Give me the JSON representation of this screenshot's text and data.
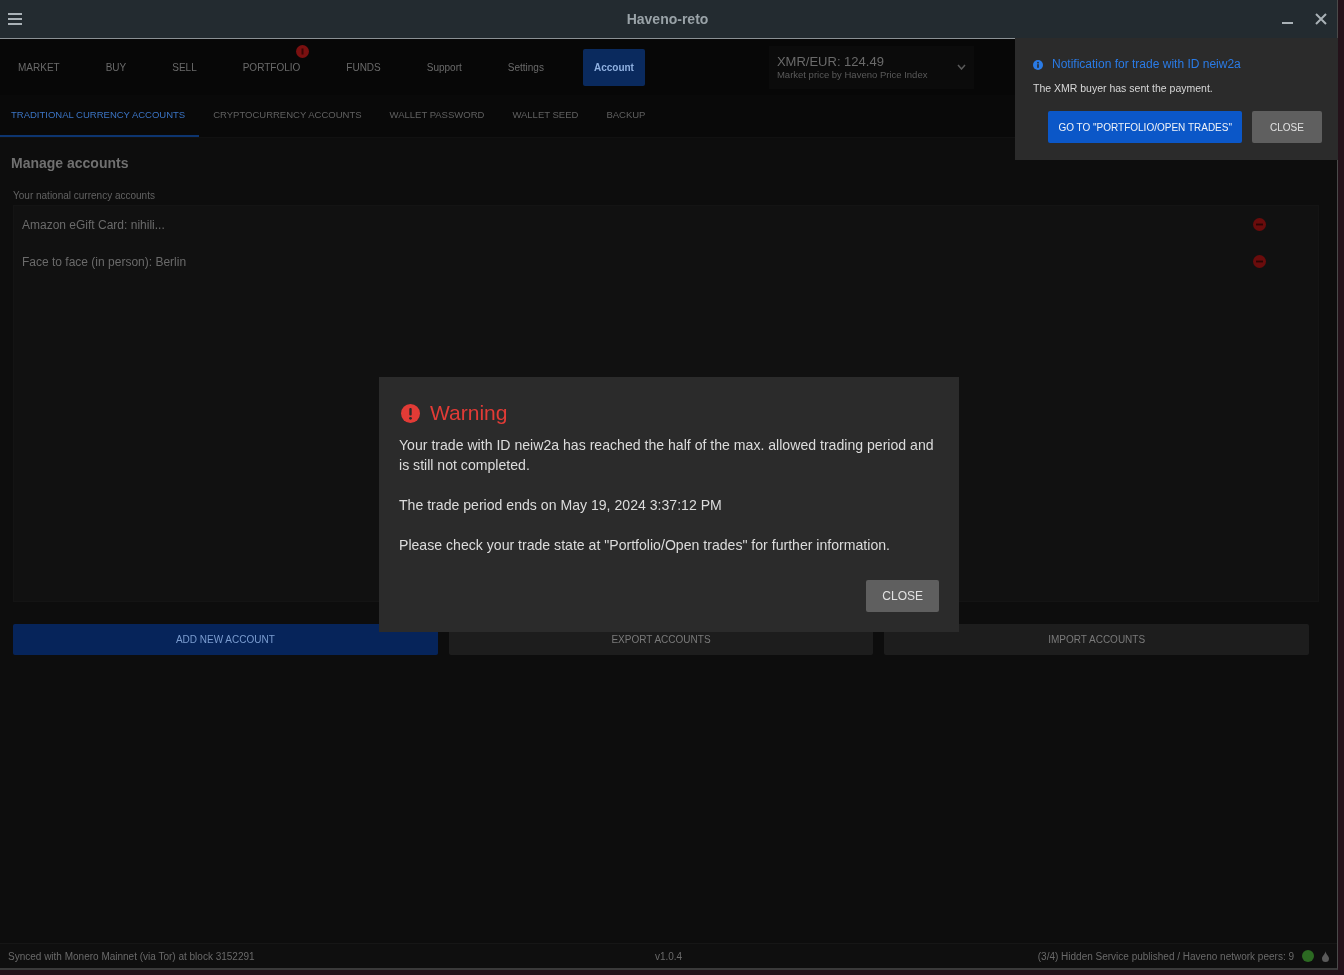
{
  "window": {
    "title": "Haveno-reto"
  },
  "nav": {
    "items": [
      {
        "label": "MARKET",
        "selected": false,
        "badge": false
      },
      {
        "label": "BUY",
        "selected": false,
        "badge": false
      },
      {
        "label": "SELL",
        "selected": false,
        "badge": false
      },
      {
        "label": "PORTFOLIO",
        "selected": false,
        "badge": true
      },
      {
        "label": "FUNDS",
        "selected": false,
        "badge": false
      },
      {
        "label": "Support",
        "selected": false,
        "badge": false
      },
      {
        "label": "Settings",
        "selected": false,
        "badge": false
      },
      {
        "label": "Account",
        "selected": true,
        "badge": false
      }
    ]
  },
  "market_price": {
    "price": "XMR/EUR: 124.49",
    "source": "Market price by Haveno Price Index"
  },
  "subtabs": [
    {
      "label": "TRADITIONAL CURRENCY ACCOUNTS",
      "selected": true
    },
    {
      "label": "CRYPTOCURRENCY ACCOUNTS",
      "selected": false
    },
    {
      "label": "WALLET PASSWORD",
      "selected": false
    },
    {
      "label": "WALLET SEED",
      "selected": false
    },
    {
      "label": "BACKUP",
      "selected": false
    }
  ],
  "content": {
    "title": "Manage accounts",
    "list_label": "Your national currency accounts",
    "accounts": [
      {
        "name": "Amazon eGift Card: nihili..."
      },
      {
        "name": "Face to face (in person): Berlin"
      }
    ],
    "buttons": [
      {
        "label": "ADD NEW ACCOUNT",
        "kind": "primary"
      },
      {
        "label": "EXPORT ACCOUNTS",
        "kind": "secondary"
      },
      {
        "label": "IMPORT ACCOUNTS",
        "kind": "secondary"
      }
    ]
  },
  "status_bar": {
    "sync": "Synced with Monero Mainnet (via Tor) at block 3152291",
    "version": "v1.0.4",
    "network": "(3/4) Hidden Service published / Haveno network peers: 9"
  },
  "dialog": {
    "title": "Warning",
    "paragraphs": [
      "Your trade with ID neiw2a has reached the half of the max. allowed trading period and is still not completed.",
      "The trade period ends on May 19, 2024 3:37:12 PM",
      "Please check your trade state at \"Portfolio/Open trades\" for further information."
    ],
    "buttons": [
      {
        "label": "CLOSE",
        "kind": "secondary"
      }
    ]
  },
  "notification": {
    "title": "Notification for trade with ID neiw2a",
    "message": "The XMR buyer has sent the payment.",
    "buttons": [
      {
        "label": "GO TO \"PORTFOLIO/OPEN TRADES\"",
        "kind": "primary"
      },
      {
        "label": "CLOSE",
        "kind": "secondary"
      }
    ]
  }
}
